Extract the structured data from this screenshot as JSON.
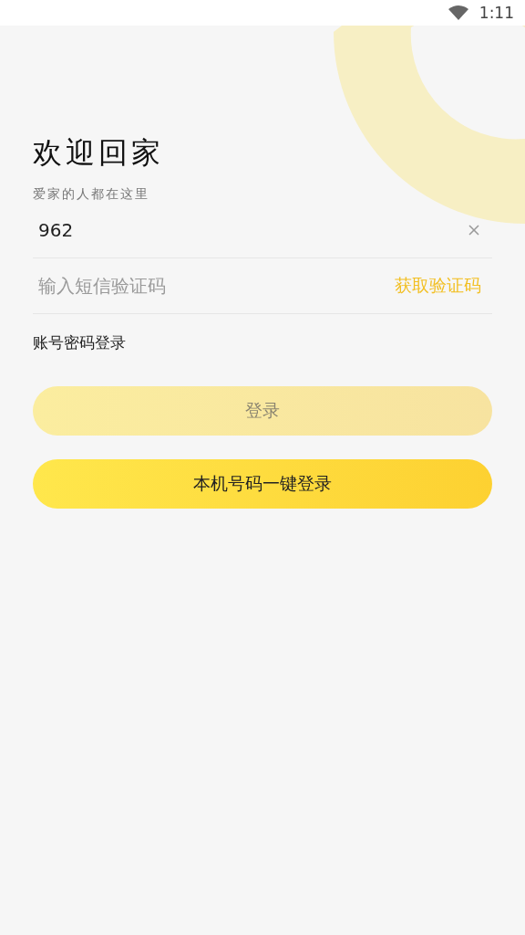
{
  "status_bar": {
    "time": "1:11"
  },
  "title": "欢迎回家",
  "subtitle": "爱家的人都在这里",
  "phone_field": {
    "value": "962"
  },
  "code_field": {
    "placeholder": "输入短信验证码",
    "action": "获取验证码"
  },
  "password_login_link": "账号密码登录",
  "buttons": [
    {
      "label": "登录",
      "kind": "secondary",
      "disabled": true
    },
    {
      "label": "本机号码一键登录",
      "kind": "primary",
      "disabled": false
    }
  ]
}
